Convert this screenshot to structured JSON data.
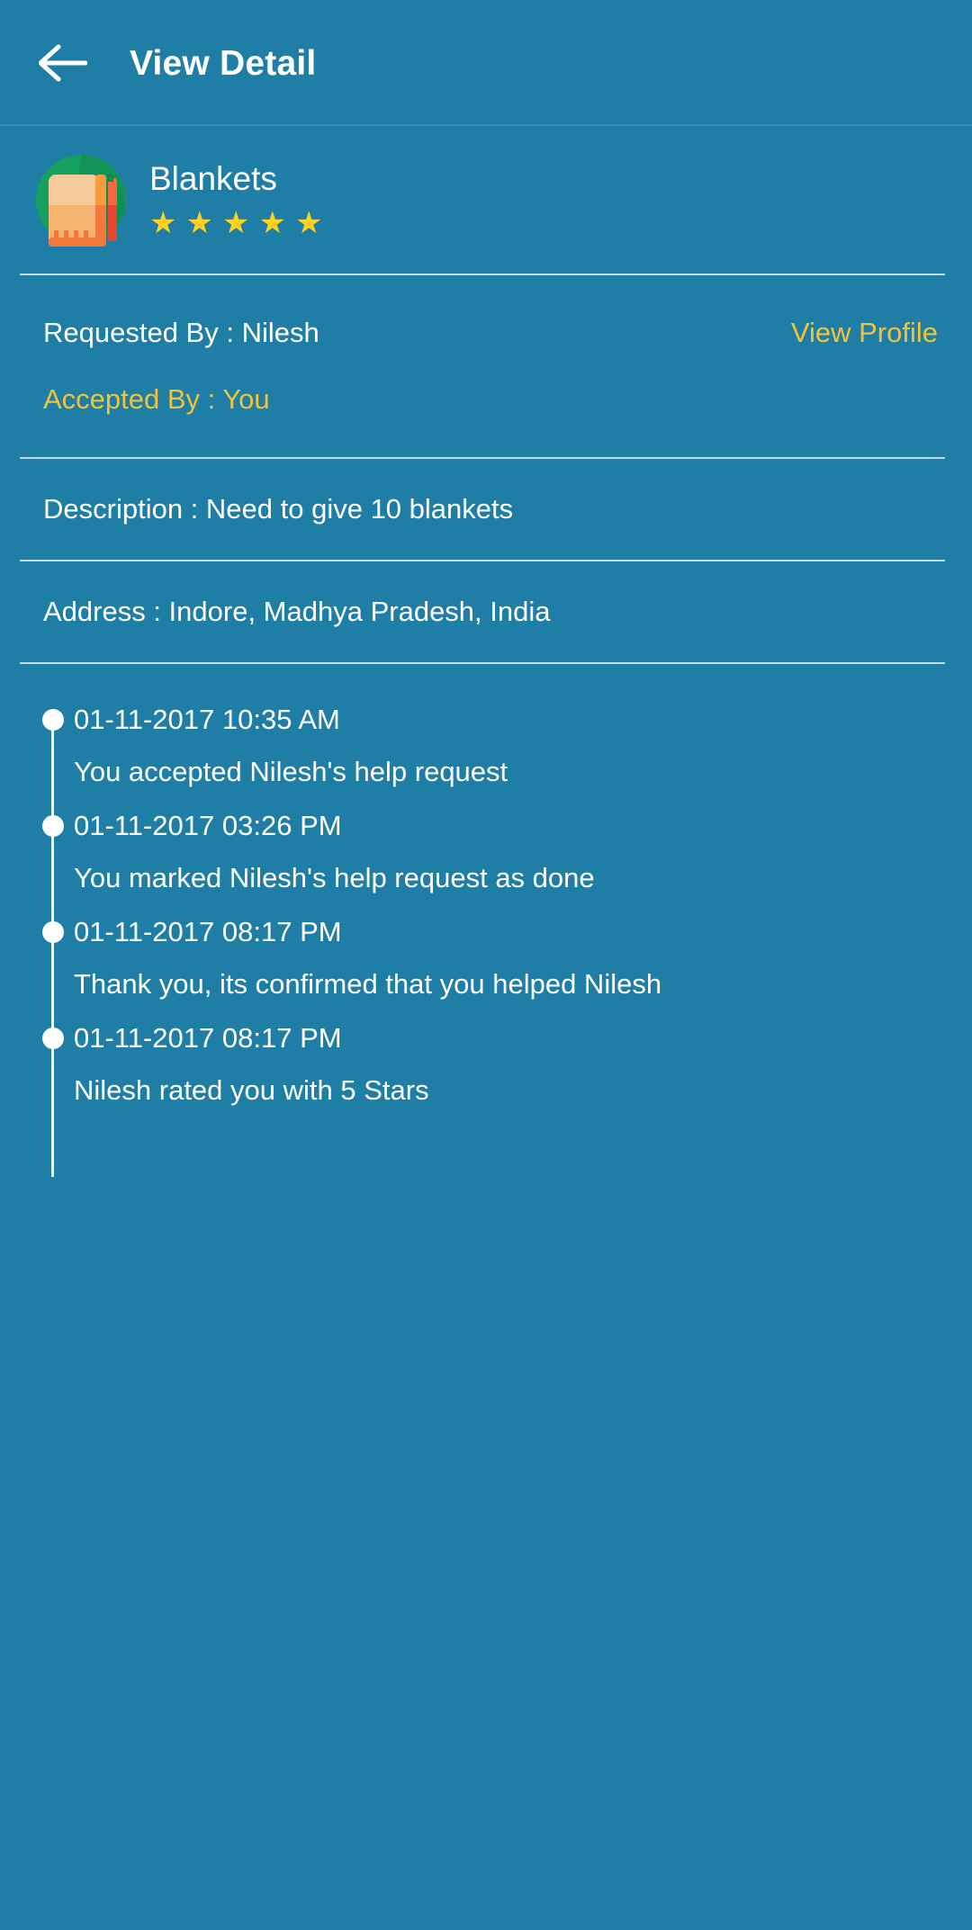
{
  "theme": {
    "background": "#1f7ea6",
    "toolbar": "#1f7ea6",
    "accent": "#f0c33c",
    "star": "#ffd21f",
    "text": "#ffffff",
    "divider": "rgba(255,255,255,0.72)"
  },
  "toolbar": {
    "back_icon": "back-arrow-icon",
    "title": "View Detail"
  },
  "item": {
    "icon": "blanket-icon",
    "title": "Blankets",
    "rating": 5,
    "rating_max": 5,
    "star_glyph": "★"
  },
  "info": {
    "requested_by": "Requested By : Nilesh",
    "view_profile": "View Profile",
    "accepted_by": "Accepted By : You",
    "description": "Description : Need to give 10 blankets",
    "address": "Address : Indore, Madhya Pradesh, India"
  },
  "timeline": [
    {
      "time": "01-11-2017 10:35 AM",
      "description": "You accepted Nilesh's help request"
    },
    {
      "time": "01-11-2017 03:26 PM",
      "description": "You marked Nilesh's help request as done"
    },
    {
      "time": "01-11-2017 08:17 PM",
      "description": "Thank you, its confirmed that you helped Nilesh"
    },
    {
      "time": "01-11-2017 08:17 PM",
      "description": "Nilesh rated you with 5 Stars"
    }
  ]
}
